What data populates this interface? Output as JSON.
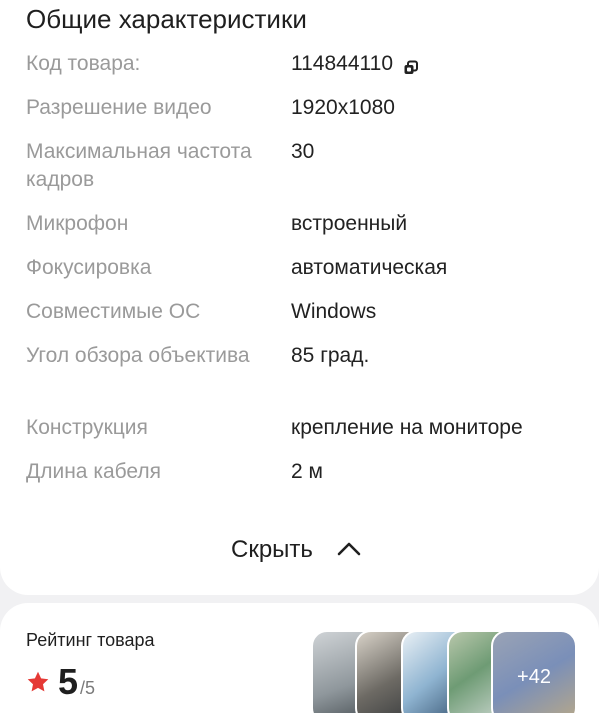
{
  "section": {
    "title": "Общие характеристики"
  },
  "specs": [
    {
      "label": "Код товара:",
      "value": "114844110",
      "copyable": true
    },
    {
      "label": "Разрешение видео",
      "value": "1920x1080"
    },
    {
      "label": "Максимальная частота кадров",
      "value": "30"
    },
    {
      "label": "Микрофон",
      "value": "встроенный"
    },
    {
      "label": "Фокусировка",
      "value": "автоматическая"
    },
    {
      "label": "Совместимые ОС",
      "value": "Windows"
    },
    {
      "label": "Угол обзора объектива",
      "value": "85 град."
    },
    {
      "label": "Конструкция",
      "value": "крепление на мониторе"
    },
    {
      "label": "Длина кабеля",
      "value": "2 м"
    }
  ],
  "toggle": {
    "label": "Скрыть",
    "icon": "chevron-up-icon"
  },
  "rating": {
    "title": "Рейтинг товара",
    "value": "5",
    "max": "/5",
    "star_color": "#e53935"
  },
  "gallery": {
    "more_label": "+42"
  }
}
